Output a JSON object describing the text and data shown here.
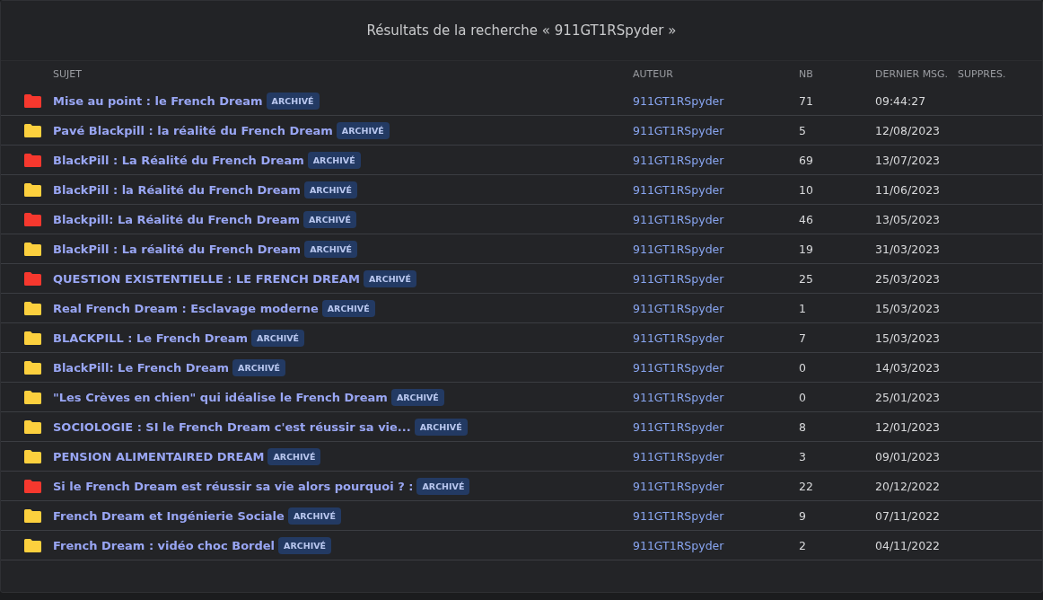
{
  "title": "Résultats de la recherche « 911GT1RSpyder »",
  "table": {
    "columns": [
      "SUJET",
      "AUTEUR",
      "NB",
      "DERNIER MSG.",
      "SUPPRES."
    ],
    "rows": [
      {
        "subject": "Mise au point : le French Dream",
        "badge": "ARCHIVÉ",
        "author": "911GT1RSpyder",
        "count": "71",
        "last": "09:44:27",
        "color": "#f6382e"
      },
      {
        "subject": "Pavé Blackpill : la réalité du French Dream",
        "badge": "ARCHIVÉ",
        "author": "911GT1RSpyder",
        "count": "5",
        "last": "12/08/2023",
        "color": "#fcd03e"
      },
      {
        "subject": "BlackPill : La Réalité du French Dream",
        "badge": "ARCHIVÉ",
        "author": "911GT1RSpyder",
        "count": "69",
        "last": "13/07/2023",
        "color": "#f6382e"
      },
      {
        "subject": "BlackPill : la Réalité du French Dream",
        "badge": "ARCHIVÉ",
        "author": "911GT1RSpyder",
        "count": "10",
        "last": "11/06/2023",
        "color": "#fcd03e"
      },
      {
        "subject": "Blackpill: La Réalité du French Dream",
        "badge": "ARCHIVÉ",
        "author": "911GT1RSpyder",
        "count": "46",
        "last": "13/05/2023",
        "color": "#f6382e"
      },
      {
        "subject": "BlackPill : La réalité du French Dream",
        "badge": "ARCHIVÉ",
        "author": "911GT1RSpyder",
        "count": "19",
        "last": "31/03/2023",
        "color": "#fcd03e"
      },
      {
        "subject": "QUESTION EXISTENTIELLE : LE FRENCH DREAM",
        "badge": "ARCHIVÉ",
        "author": "911GT1RSpyder",
        "count": "25",
        "last": "25/03/2023",
        "color": "#f6382e"
      },
      {
        "subject": "Real French Dream : Esclavage moderne",
        "badge": "ARCHIVÉ",
        "author": "911GT1RSpyder",
        "count": "1",
        "last": "15/03/2023",
        "color": "#fcd03e"
      },
      {
        "subject": "BLACKPILL : Le French Dream",
        "badge": "ARCHIVÉ",
        "author": "911GT1RSpyder",
        "count": "7",
        "last": "15/03/2023",
        "color": "#fcd03e"
      },
      {
        "subject": "BlackPill: Le French Dream",
        "badge": "ARCHIVÉ",
        "author": "911GT1RSpyder",
        "count": "0",
        "last": "14/03/2023",
        "color": "#fcd03e"
      },
      {
        "subject": "\"Les Crèves en chien\" qui idéalise le French Dream",
        "badge": "ARCHIVÉ",
        "author": "911GT1RSpyder",
        "count": "0",
        "last": "25/01/2023",
        "color": "#fcd03e"
      },
      {
        "subject": "SOCIOLOGIE : SI le French Dream c'est réussir sa vie...",
        "badge": "ARCHIVÉ",
        "author": "911GT1RSpyder",
        "count": "8",
        "last": "12/01/2023",
        "color": "#fcd03e"
      },
      {
        "subject": "PENSION ALIMENTAIRED DREAM",
        "badge": "ARCHIVÉ",
        "author": "911GT1RSpyder",
        "count": "3",
        "last": "09/01/2023",
        "color": "#fcd03e"
      },
      {
        "subject": "Si le French Dream est réussir sa vie alors pourquoi ? :",
        "badge": "ARCHIVÉ",
        "author": "911GT1RSpyder",
        "count": "22",
        "last": "20/12/2022",
        "color": "#f6382e"
      },
      {
        "subject": "French Dream et Ingénierie Sociale",
        "badge": "ARCHIVÉ",
        "author": "911GT1RSpyder",
        "count": "9",
        "last": "07/11/2022",
        "color": "#fcd03e"
      },
      {
        "subject": "French Dream : vidéo choc Bordel",
        "badge": "ARCHIVÉ",
        "author": "911GT1RSpyder",
        "count": "2",
        "last": "04/11/2022",
        "color": "#fcd03e"
      }
    ]
  }
}
